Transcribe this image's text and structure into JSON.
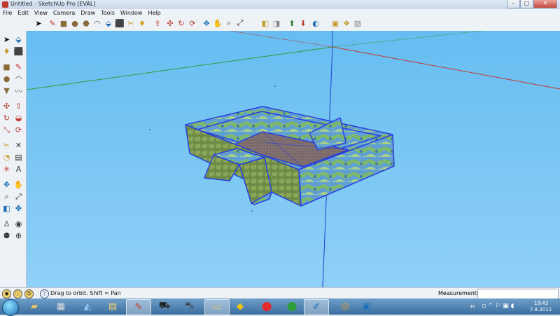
{
  "window": {
    "title": "Untitled - SketchUp Pro [EVAL]",
    "minimize": "–",
    "maximize": "▢",
    "close": "✕"
  },
  "menus": [
    "File",
    "Edit",
    "View",
    "Camera",
    "Draw",
    "Tools",
    "Window",
    "Help"
  ],
  "status": {
    "hint": "Drag to orbit.  Shift = Pan",
    "measurements_label": "Measurements",
    "measurements_value": ""
  },
  "tray": {
    "lang": "FI",
    "time": "19:43",
    "date": "7.8.2012"
  },
  "colors": {
    "sky": "#7cc8f3",
    "axis_red": "#c0392b",
    "axis_green": "#2e9e3a",
    "axis_blue": "#1f3fd1",
    "selection": "#2a3fe0"
  }
}
